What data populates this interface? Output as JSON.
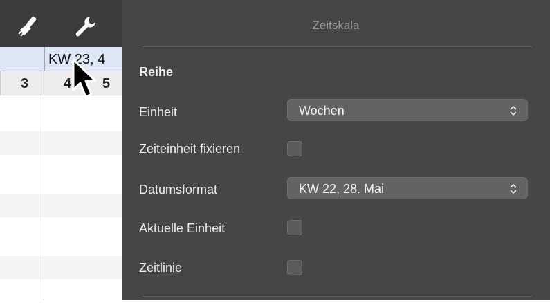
{
  "toolbar": {
    "icons": [
      "brush-icon",
      "wrench-icon"
    ]
  },
  "grid": {
    "header_week": "KW 23, 4",
    "day_cells": [
      "3",
      "4",
      "5"
    ]
  },
  "inspector": {
    "title": "Zeitskala",
    "section": "Reihe",
    "unit": {
      "label": "Einheit",
      "value": "Wochen"
    },
    "fix_unit": {
      "label": "Zeiteinheit fixieren",
      "checked": false
    },
    "date_format": {
      "label": "Datumsformat",
      "value": "KW 22, 28. Mai"
    },
    "current_unit": {
      "label": "Aktuelle Einheit",
      "checked": false
    },
    "timeline": {
      "label": "Zeitlinie",
      "checked": false
    }
  },
  "colors": {
    "panel_bg": "#464646",
    "toolbar_bg": "#3b3b3b",
    "header_blue": "#dce6f5"
  }
}
